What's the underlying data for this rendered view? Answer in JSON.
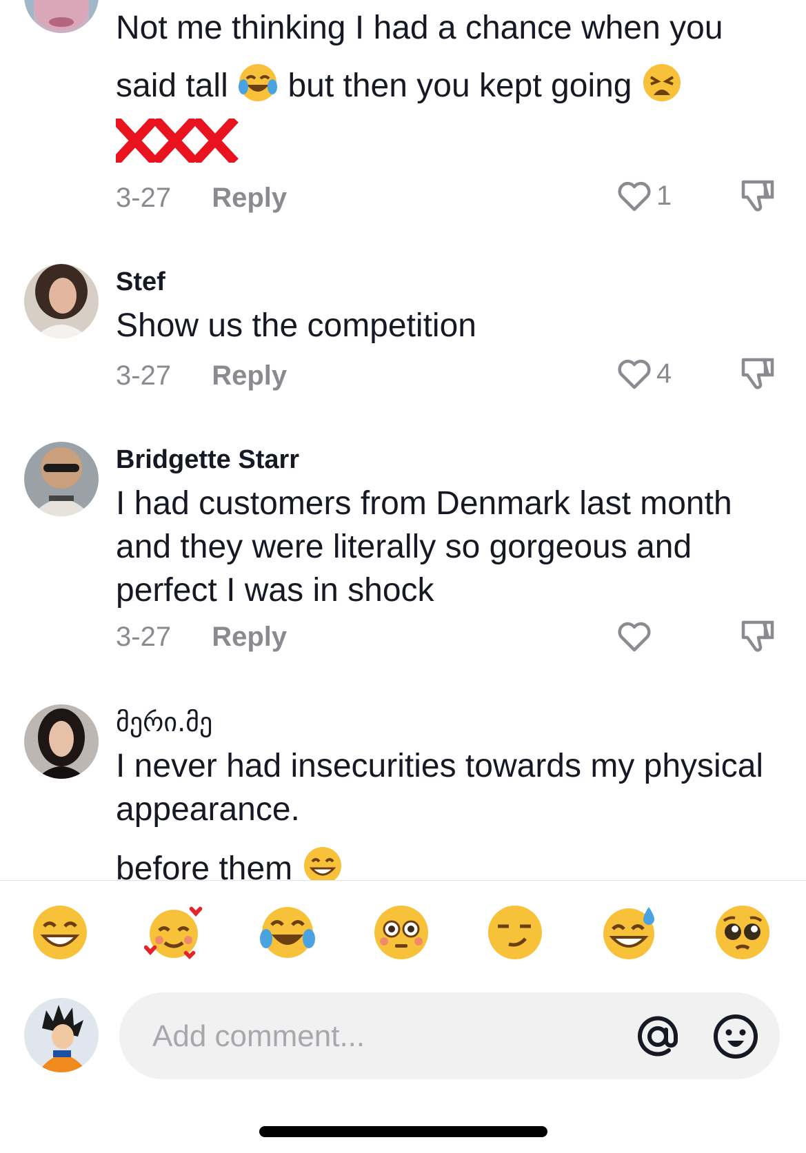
{
  "comments": [
    {
      "username": "",
      "text_line1": "Not me thinking I had a chance when you",
      "text_line2a": "said tall",
      "text_line2b": "but then you kept going",
      "marks": "XXX",
      "date": "3-27",
      "reply_label": "Reply",
      "likes": "1",
      "avatar_icon": "avatar-partial"
    },
    {
      "username": "Stef",
      "text": "Show us the competition",
      "date": "3-27",
      "reply_label": "Reply",
      "likes": "4"
    },
    {
      "username": "Bridgette Starr",
      "text_lines": [
        "I had customers from Denmark last month",
        "and they were literally so gorgeous and",
        "perfect I was in shock"
      ],
      "date": "3-27",
      "reply_label": "Reply",
      "likes": ""
    },
    {
      "username": "მერი.მე",
      "text_lines": [
        "I never had insecurities towards my physical",
        "appearance."
      ],
      "text_extra": "before them"
    }
  ],
  "emoji_bar": [
    "grinning-face",
    "smiling-face-with-hearts",
    "face-with-tears-of-joy",
    "flushed-face",
    "smirking-face",
    "grinning-face-with-sweat",
    "pleading-face"
  ],
  "composer": {
    "placeholder": "Add comment...",
    "at_icon": "at-sign-icon",
    "emoji_icon": "smiley-icon"
  },
  "colors": {
    "text": "#161823",
    "secondary": "#8a8b91",
    "input_bg": "#f1f1f2",
    "mark_red": "#e8131f"
  }
}
